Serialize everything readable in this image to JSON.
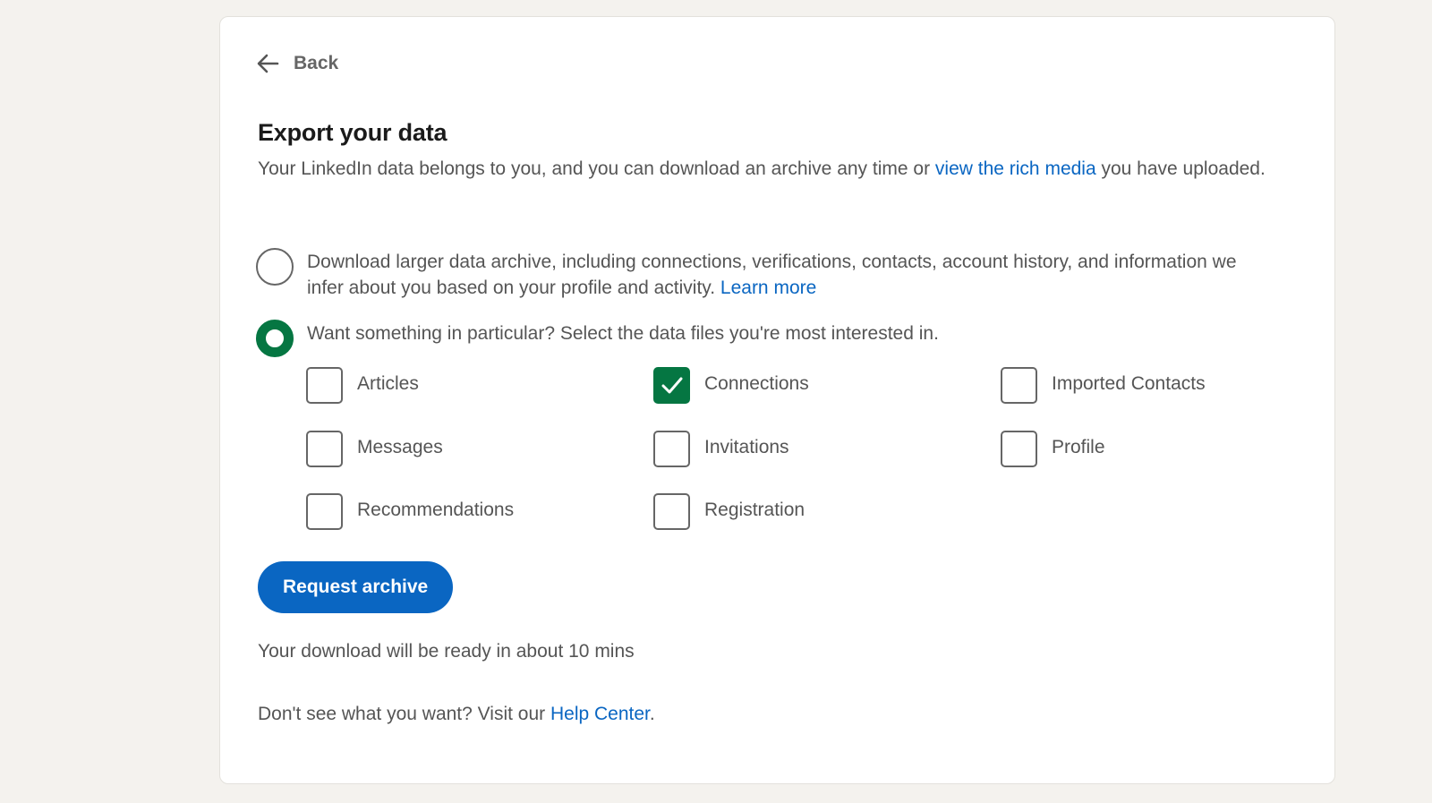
{
  "back": {
    "label": "Back",
    "icon": "arrow-left-icon"
  },
  "page": {
    "title": "Export your data",
    "description_before": "Your LinkedIn data belongs to you, and you can download an archive any time or ",
    "description_link": "view the rich media",
    "description_after": " you have uploaded."
  },
  "options": {
    "larger_archive": {
      "text": "Download larger data archive, including connections, verifications, contacts, account history, and information we infer about you based on your profile and activity.",
      "link": "Learn more",
      "selected": false
    },
    "particular": {
      "text": "Want something in particular? Select the data files you're most interested in.",
      "selected": true
    }
  },
  "checkboxes": [
    {
      "label": "Articles",
      "checked": false
    },
    {
      "label": "Connections",
      "checked": true
    },
    {
      "label": "Imported Contacts",
      "checked": false
    },
    {
      "label": "Messages",
      "checked": false
    },
    {
      "label": "Invitations",
      "checked": false
    },
    {
      "label": "Profile",
      "checked": false
    },
    {
      "label": "Recommendations",
      "checked": false
    },
    {
      "label": "Registration",
      "checked": false
    }
  ],
  "actions": {
    "request_label": "Request archive"
  },
  "footer": {
    "ready_note": "Your download will be ready in about 10 mins",
    "help_before": "Don't see what you want? Visit our ",
    "help_link": "Help Center",
    "help_after": "."
  },
  "colors": {
    "accent_blue": "#0a66c2",
    "check_green": "#057642",
    "page_background": "#f4f2ee"
  }
}
